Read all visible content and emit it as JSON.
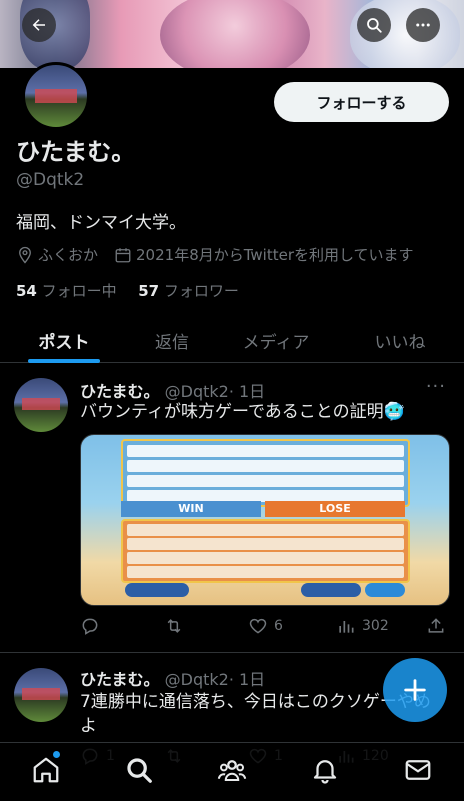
{
  "profile": {
    "name": "ひたまむ。",
    "handle": "@Dqtk2",
    "bio": "福岡、ドンマイ大学。",
    "location": "ふくおか",
    "joined": "2021年8月からTwitterを利用しています",
    "following_count": "54",
    "following_label": "フォロー中",
    "followers_count": "57",
    "followers_label": "フォロワー",
    "follow_button": "フォローする"
  },
  "tabs": [
    {
      "label": "ポスト",
      "active": true
    },
    {
      "label": "返信",
      "active": false
    },
    {
      "label": "メディア",
      "active": false
    },
    {
      "label": "いいね",
      "active": false
    }
  ],
  "posts": [
    {
      "name": "ひたまむ。",
      "handle": "@Dqtk2",
      "time": "· 1日",
      "text": "バウンティが味方ゲーであることの証明🥶",
      "media_win": "WIN",
      "media_lose": "LOSE",
      "replies": "",
      "reposts": "",
      "likes": "6",
      "views": "302"
    },
    {
      "name": "ひたまむ。",
      "handle": "@Dqtk2",
      "time": "· 1日",
      "text_line1": "7連勝中に通信落ち、今日はこのクソゲーやめ",
      "text_line2": "よ",
      "replies": "1",
      "reposts": "",
      "likes": "1",
      "views": "120"
    }
  ],
  "icons": {
    "back": "back-arrow-icon",
    "search": "search-icon",
    "more": "more-icon",
    "compose": "compose-plus-icon"
  },
  "colors": {
    "accent": "#1d9bf0",
    "background": "#000000",
    "secondary_text": "#71767b"
  }
}
